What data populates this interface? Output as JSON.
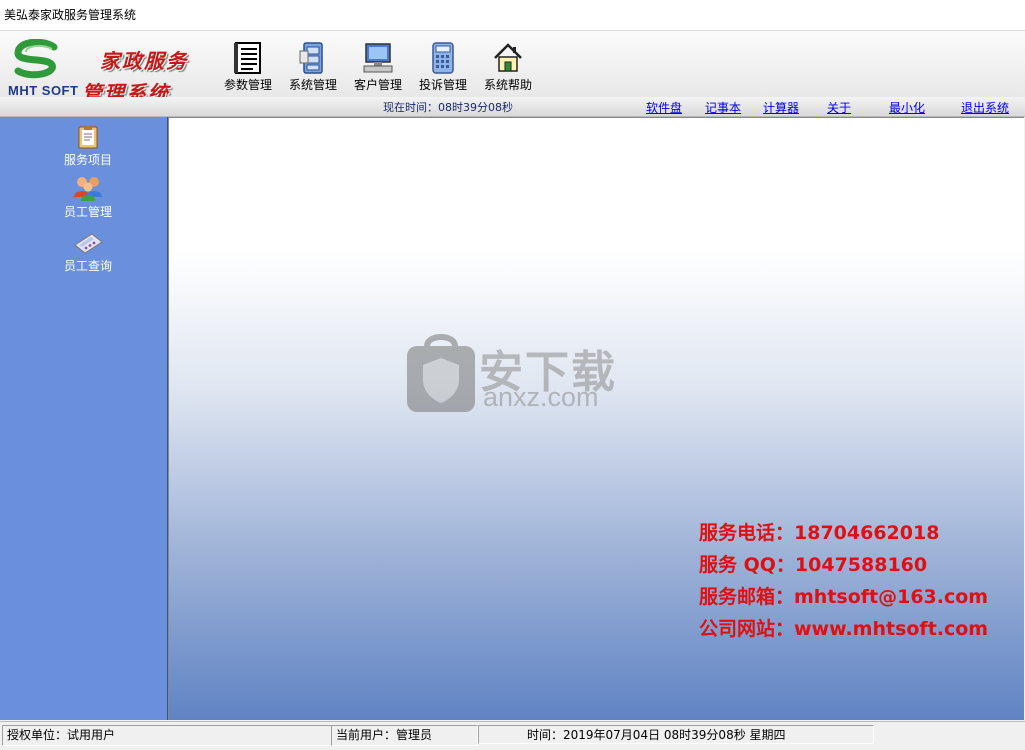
{
  "window": {
    "title": "美弘泰家政服务管理系统"
  },
  "logo": {
    "brand": "MHT SOFT",
    "line1": "家政服务",
    "line2": "管理系统"
  },
  "toolbar": [
    {
      "label": "参数管理",
      "icon": "ledger-icon"
    },
    {
      "label": "系统管理",
      "icon": "file-cabinet-icon"
    },
    {
      "label": "客户管理",
      "icon": "computer-icon"
    },
    {
      "label": "投诉管理",
      "icon": "calculator-icon"
    },
    {
      "label": "系统帮助",
      "icon": "home-icon"
    }
  ],
  "linkbar": {
    "clock": "现在时间：08时39分08秒",
    "links": [
      "软件盘",
      "记事本",
      "计算器",
      "关于",
      "最小化",
      "退出系统"
    ]
  },
  "sidebar": [
    {
      "label": "服务项目",
      "icon": "clipboard-icon"
    },
    {
      "label": "员工管理",
      "icon": "users-icon"
    },
    {
      "label": "员工查询",
      "icon": "calculator-search-icon"
    }
  ],
  "watermark": {
    "cn": "安下载",
    "en": "anxz.com",
    "badge": "安"
  },
  "contact": [
    "服务电话：18704662018",
    "服务 QQ：1047588160",
    "服务邮箱：mhtsoft@163.com",
    "公司网站：www.mhtsoft.com"
  ],
  "status": {
    "unit": "授权单位：试用用户",
    "user": "当前用户：管理员",
    "time": "时间：2019年07月04日  08时39分08秒  星期四"
  },
  "colors": {
    "sidebar": "#6a8fdc",
    "contact": "#e01010",
    "logo_red": "#c71818"
  }
}
